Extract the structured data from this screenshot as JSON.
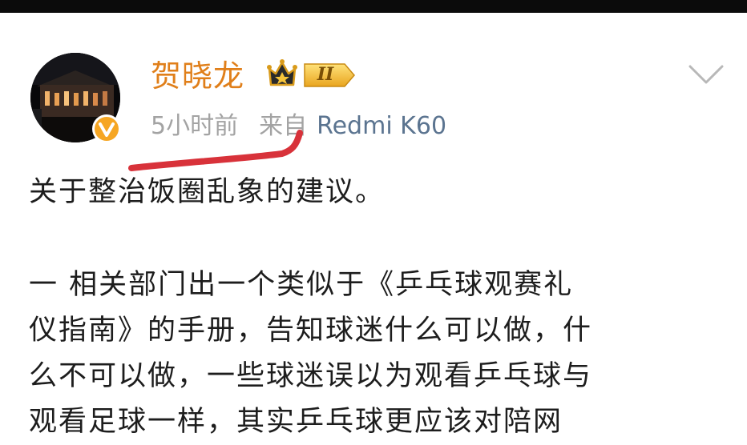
{
  "user": {
    "name": "贺晓龙",
    "vip_level": "II",
    "icons": [
      "avatar",
      "verified-badge-icon",
      "crown-icon",
      "chevron-down-icon"
    ]
  },
  "post_meta": {
    "time": "5小时前",
    "source_label": "来自",
    "device": "Redmi K60"
  },
  "post": {
    "title_line": "关于整治饭圈乱象的建议。",
    "paragraph_rows": [
      "一 相关部门出一个类似于《乒乓球观赛礼",
      "仪指南》的手册，告知球迷什么可以做，什",
      "么不可以做，一些球迷误以为观看乒乓球与",
      "观看足球一样，其实乒乓球更应该对陪网"
    ]
  },
  "colors": {
    "username": "#e07f1a",
    "meta_gray": "#a3a3a3",
    "device_blue": "#5b7490",
    "annotation_red": "#d8323a",
    "text": "#1d1d1d"
  }
}
